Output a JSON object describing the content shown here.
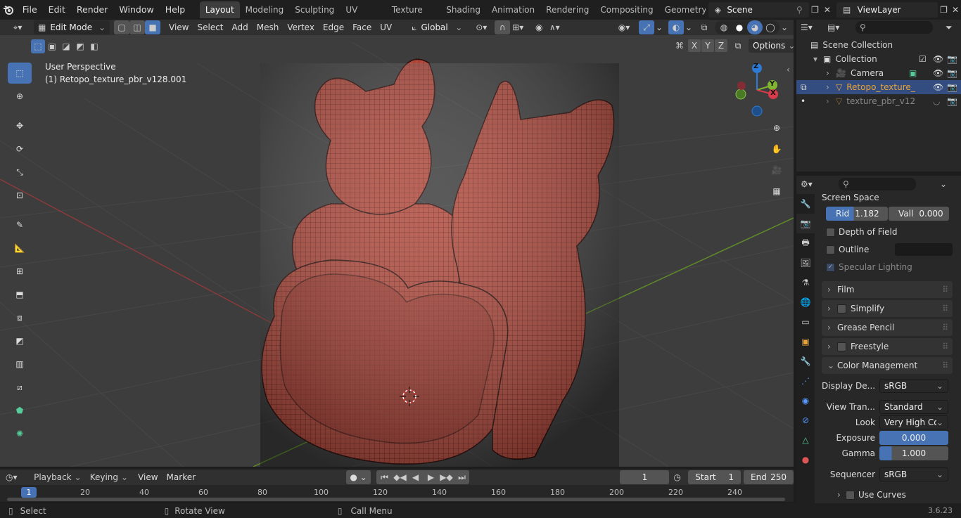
{
  "top_menu": [
    "File",
    "Edit",
    "Render",
    "Window",
    "Help"
  ],
  "workspaces": [
    "Layout",
    "Modeling",
    "Sculpting",
    "UV Editing",
    "Texture Paint",
    "Shading",
    "Animation",
    "Rendering",
    "Compositing",
    "Geometry Noc"
  ],
  "scene_name": "Scene",
  "view_layer": "ViewLayer",
  "viewport_header": {
    "mode": "Edit Mode",
    "menus": [
      "View",
      "Select",
      "Add",
      "Mesh",
      "Vertex",
      "Edge",
      "Face",
      "UV"
    ],
    "transform_orientation": "Global",
    "options_label": "Options",
    "axis_labels": [
      "X",
      "Y",
      "Z"
    ]
  },
  "viewport": {
    "perspective_label": "User Perspective",
    "object_label": "(1) Retopo_texture_pbr_v128.001",
    "gizmo_axes": [
      "Z",
      "Y",
      "X"
    ]
  },
  "outliner": {
    "scene_collection": "Scene Collection",
    "collection": "Collection",
    "items": [
      "Camera",
      "Retopo_texture_",
      "texture_pbr_v12"
    ]
  },
  "properties": {
    "screen_space_label": "Screen Space",
    "rid_label": "Rid",
    "rid_value": "1.182",
    "vall_label": "Vall",
    "vall_value": "0.000",
    "depth_of_field": "Depth of Field",
    "outline": "Outline",
    "specular_lighting": "Specular Lighting",
    "panels": [
      "Film",
      "Simplify",
      "Grease Pencil",
      "Freestyle",
      "Color Management"
    ],
    "display_device_label": "Display De...",
    "display_device_value": "sRGB",
    "view_transform_label": "View Tran...",
    "view_transform_value": "Standard",
    "look_label": "Look",
    "look_value": "Very High Co...",
    "exposure_label": "Exposure",
    "exposure_value": "0.000",
    "gamma_label": "Gamma",
    "gamma_value": "1.000",
    "sequencer_label": "Sequencer",
    "sequencer_value": "sRGB",
    "use_curves": "Use Curves"
  },
  "timeline": {
    "menus": [
      "Playback",
      "Keying",
      "View",
      "Marker"
    ],
    "current_frame": "1",
    "start_label": "Start",
    "start_value": "1",
    "end_label": "End",
    "end_value": "250",
    "ticks": [
      "1",
      "20",
      "40",
      "60",
      "80",
      "100",
      "120",
      "140",
      "160",
      "180",
      "200",
      "220",
      "240"
    ]
  },
  "statusbar": {
    "select": "Select",
    "rotate_view": "Rotate View",
    "call_menu": "Call Menu",
    "version": "3.6.23"
  },
  "colors": {
    "accent": "#4772b3",
    "active_object": "#e8a43a",
    "mesh_red": "#b5473a"
  }
}
